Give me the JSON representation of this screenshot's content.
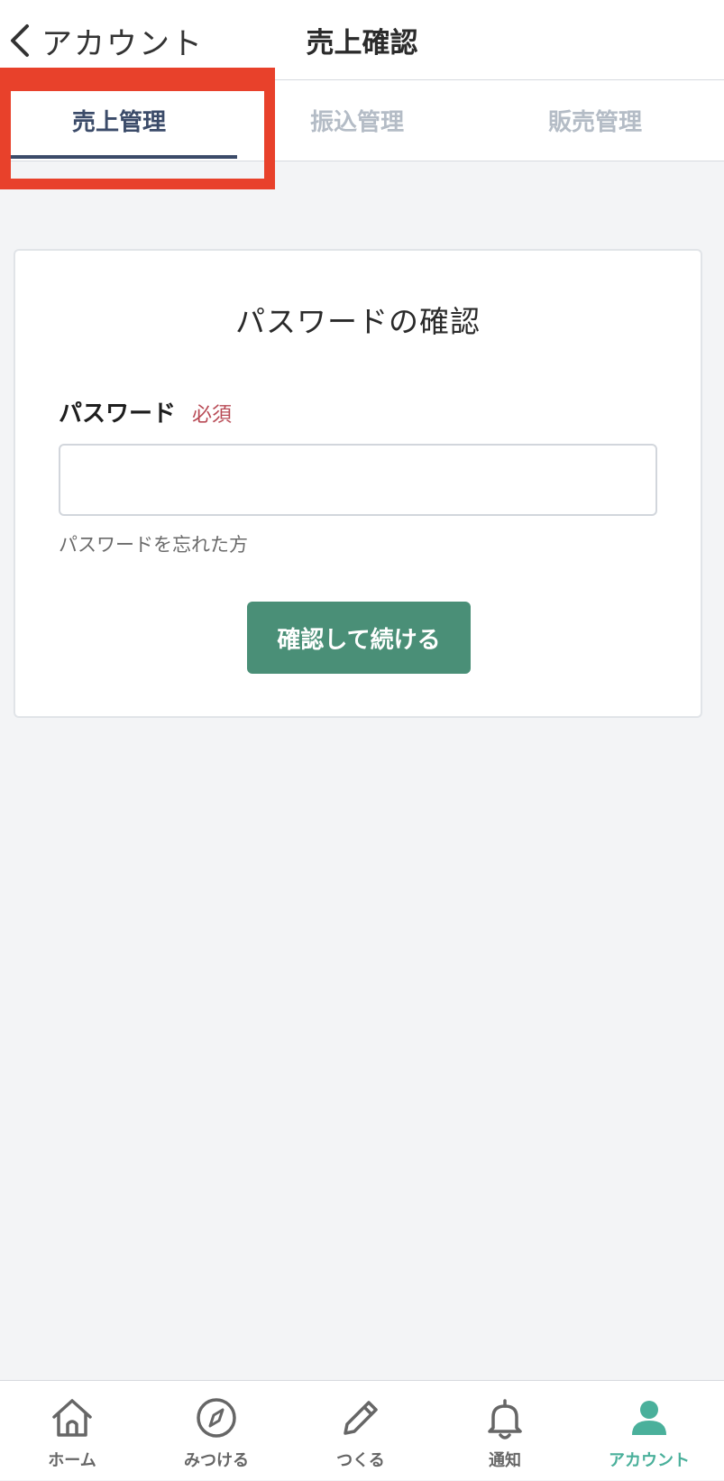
{
  "header": {
    "back_label": "アカウント",
    "title": "売上確認"
  },
  "tabs": [
    {
      "label": "売上管理",
      "active": true
    },
    {
      "label": "振込管理",
      "active": false
    },
    {
      "label": "販売管理",
      "active": false
    }
  ],
  "card": {
    "title": "パスワードの確認",
    "field_label": "パスワード",
    "required_badge": "必須",
    "password_value": "",
    "forgot_link": "パスワードを忘れた方",
    "confirm_button": "確認して続ける"
  },
  "bottom_nav": [
    {
      "label": "ホーム",
      "icon": "home-icon",
      "active": false
    },
    {
      "label": "みつける",
      "icon": "compass-icon",
      "active": false
    },
    {
      "label": "つくる",
      "icon": "pencil-icon",
      "active": false
    },
    {
      "label": "通知",
      "icon": "bell-icon",
      "active": false
    },
    {
      "label": "アカウント",
      "icon": "person-icon",
      "active": true
    }
  ],
  "colors": {
    "accent": "#4a8f77",
    "active_tab": "#3b4b69",
    "active_nav": "#4ab09b",
    "highlight": "#e8412b",
    "required": "#b84a55"
  }
}
